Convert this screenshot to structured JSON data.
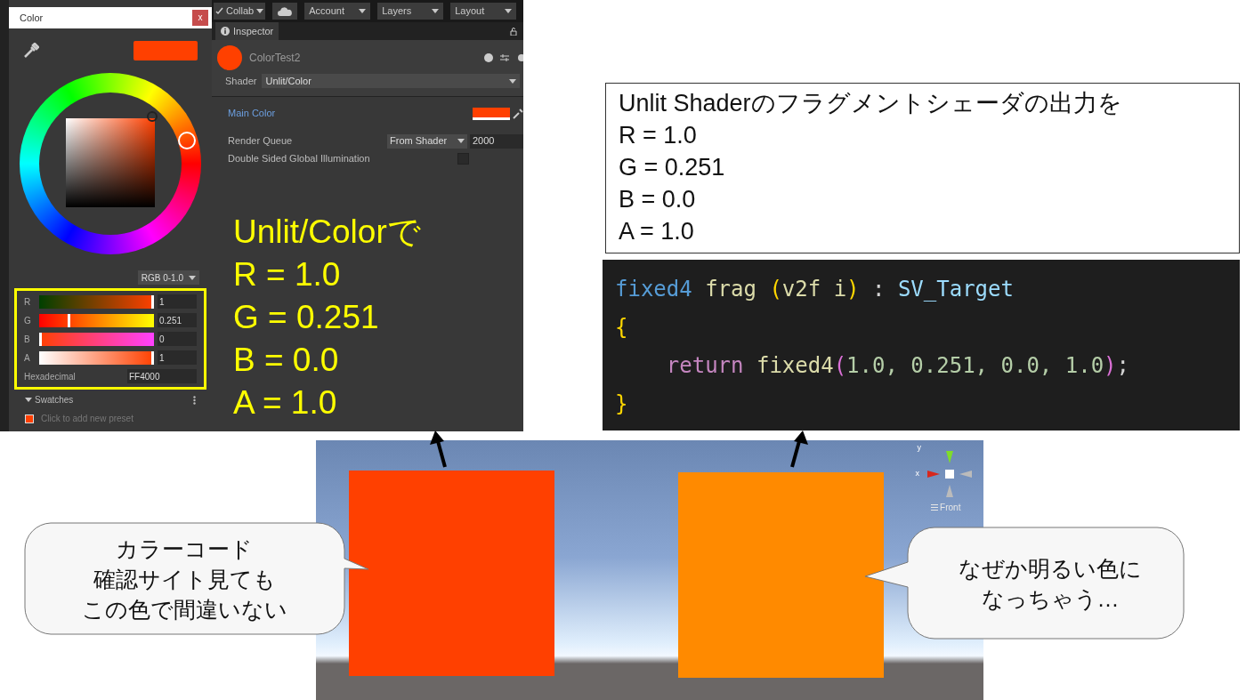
{
  "color_window": {
    "title": "Color",
    "close_label": "x",
    "mode": "RGB 0-1.0",
    "channels": [
      {
        "label": "R",
        "value": "1",
        "level": 1
      },
      {
        "label": "G",
        "value": "0.251",
        "level": 0.251
      },
      {
        "label": "B",
        "value": "0",
        "level": 0
      },
      {
        "label": "A",
        "value": "1",
        "level": 1
      }
    ],
    "hex_label": "Hexadecimal",
    "hex_value": "FF4000",
    "swatches_label": "Swatches",
    "preset_label": "Click to add new preset"
  },
  "toolbar": [
    {
      "label": "Collab",
      "kind": "check-dropdown"
    },
    {
      "kind": "cloud"
    },
    {
      "label": "Account",
      "kind": "dropdown"
    },
    {
      "label": "Layers",
      "kind": "dropdown"
    },
    {
      "label": "Layout",
      "kind": "dropdown"
    }
  ],
  "inspector": {
    "tab": "Inspector",
    "object_name": "ColorTest2",
    "shader_label": "Shader",
    "shader_value": "Unlit/Color",
    "properties": [
      {
        "kind": "color",
        "label": "Main Color"
      },
      {
        "kind": "queue",
        "label": "Render Queue",
        "option": "From Shader",
        "value": "2000"
      },
      {
        "kind": "checkbox",
        "label": "Double Sided Global Illumination",
        "checked": false
      }
    ]
  },
  "annotation": [
    "Unlit/Colorで",
    "R = 1.0",
    "G = 0.251",
    "B = 0.0",
    "A = 1.0"
  ],
  "note": [
    "Unlit Shaderのフラグメントシェーダの出力を",
    "R = 1.0",
    "G = 0.251",
    "B = 0.0",
    "A = 1.0"
  ],
  "code": [
    [
      {
        "text": "fixed4",
        "kind": "type"
      },
      {
        "text": " frag ",
        "kind": "func"
      },
      {
        "text": "(",
        "kind": "paren"
      },
      {
        "text": "v2f i",
        "kind": "func"
      },
      {
        "text": ")",
        "kind": "paren"
      },
      {
        "text": " : ",
        "kind": "plain"
      },
      {
        "text": "SV_Target",
        "kind": "semantic"
      }
    ],
    [
      {
        "text": "{",
        "kind": "paren"
      }
    ],
    [
      {
        "text": "    return",
        "kind": "keyword"
      },
      {
        "text": " fixed4",
        "kind": "func"
      },
      {
        "text": "(",
        "kind": "paren2"
      },
      {
        "text": "1.0, 0.251, 0.0, 1.0",
        "kind": "number"
      },
      {
        "text": ")",
        "kind": "paren2"
      },
      {
        "text": ";",
        "kind": "plain"
      }
    ],
    [
      {
        "text": "}",
        "kind": "paren"
      }
    ]
  ],
  "scene": {
    "axis_x": "x",
    "axis_y": "y",
    "view_label": "Front",
    "quads": [
      {
        "color": "#ff4000"
      },
      {
        "color": "#ff8a00"
      }
    ]
  },
  "bubbles": [
    {
      "lines": [
        "カラーコード",
        "確認サイト見ても",
        "この色で間違いない"
      ]
    },
    {
      "lines": [
        "なぜか明るい色に",
        "なっちゃう…"
      ]
    }
  ]
}
